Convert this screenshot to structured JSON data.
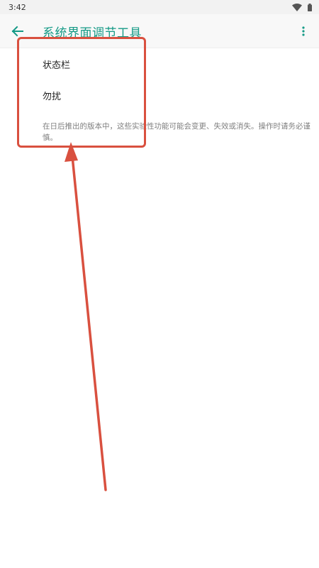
{
  "status_bar": {
    "time": "3:42",
    "icons": [
      "wifi-icon",
      "battery-icon"
    ]
  },
  "app_bar": {
    "title": "系统界面调节工具",
    "back_icon": "arrow-back-icon",
    "more_icon": "more-vert-icon",
    "accent_color": "#159a86"
  },
  "settings": {
    "items": [
      {
        "label": "状态栏"
      },
      {
        "label": "勿扰"
      }
    ],
    "note": "在日后推出的版本中，这些实验性功能可能会变更、失效或消失。操作时请务必谨慎。"
  },
  "annotation": {
    "color": "#d9503f",
    "shapes": [
      "highlight-box",
      "arrow"
    ]
  }
}
